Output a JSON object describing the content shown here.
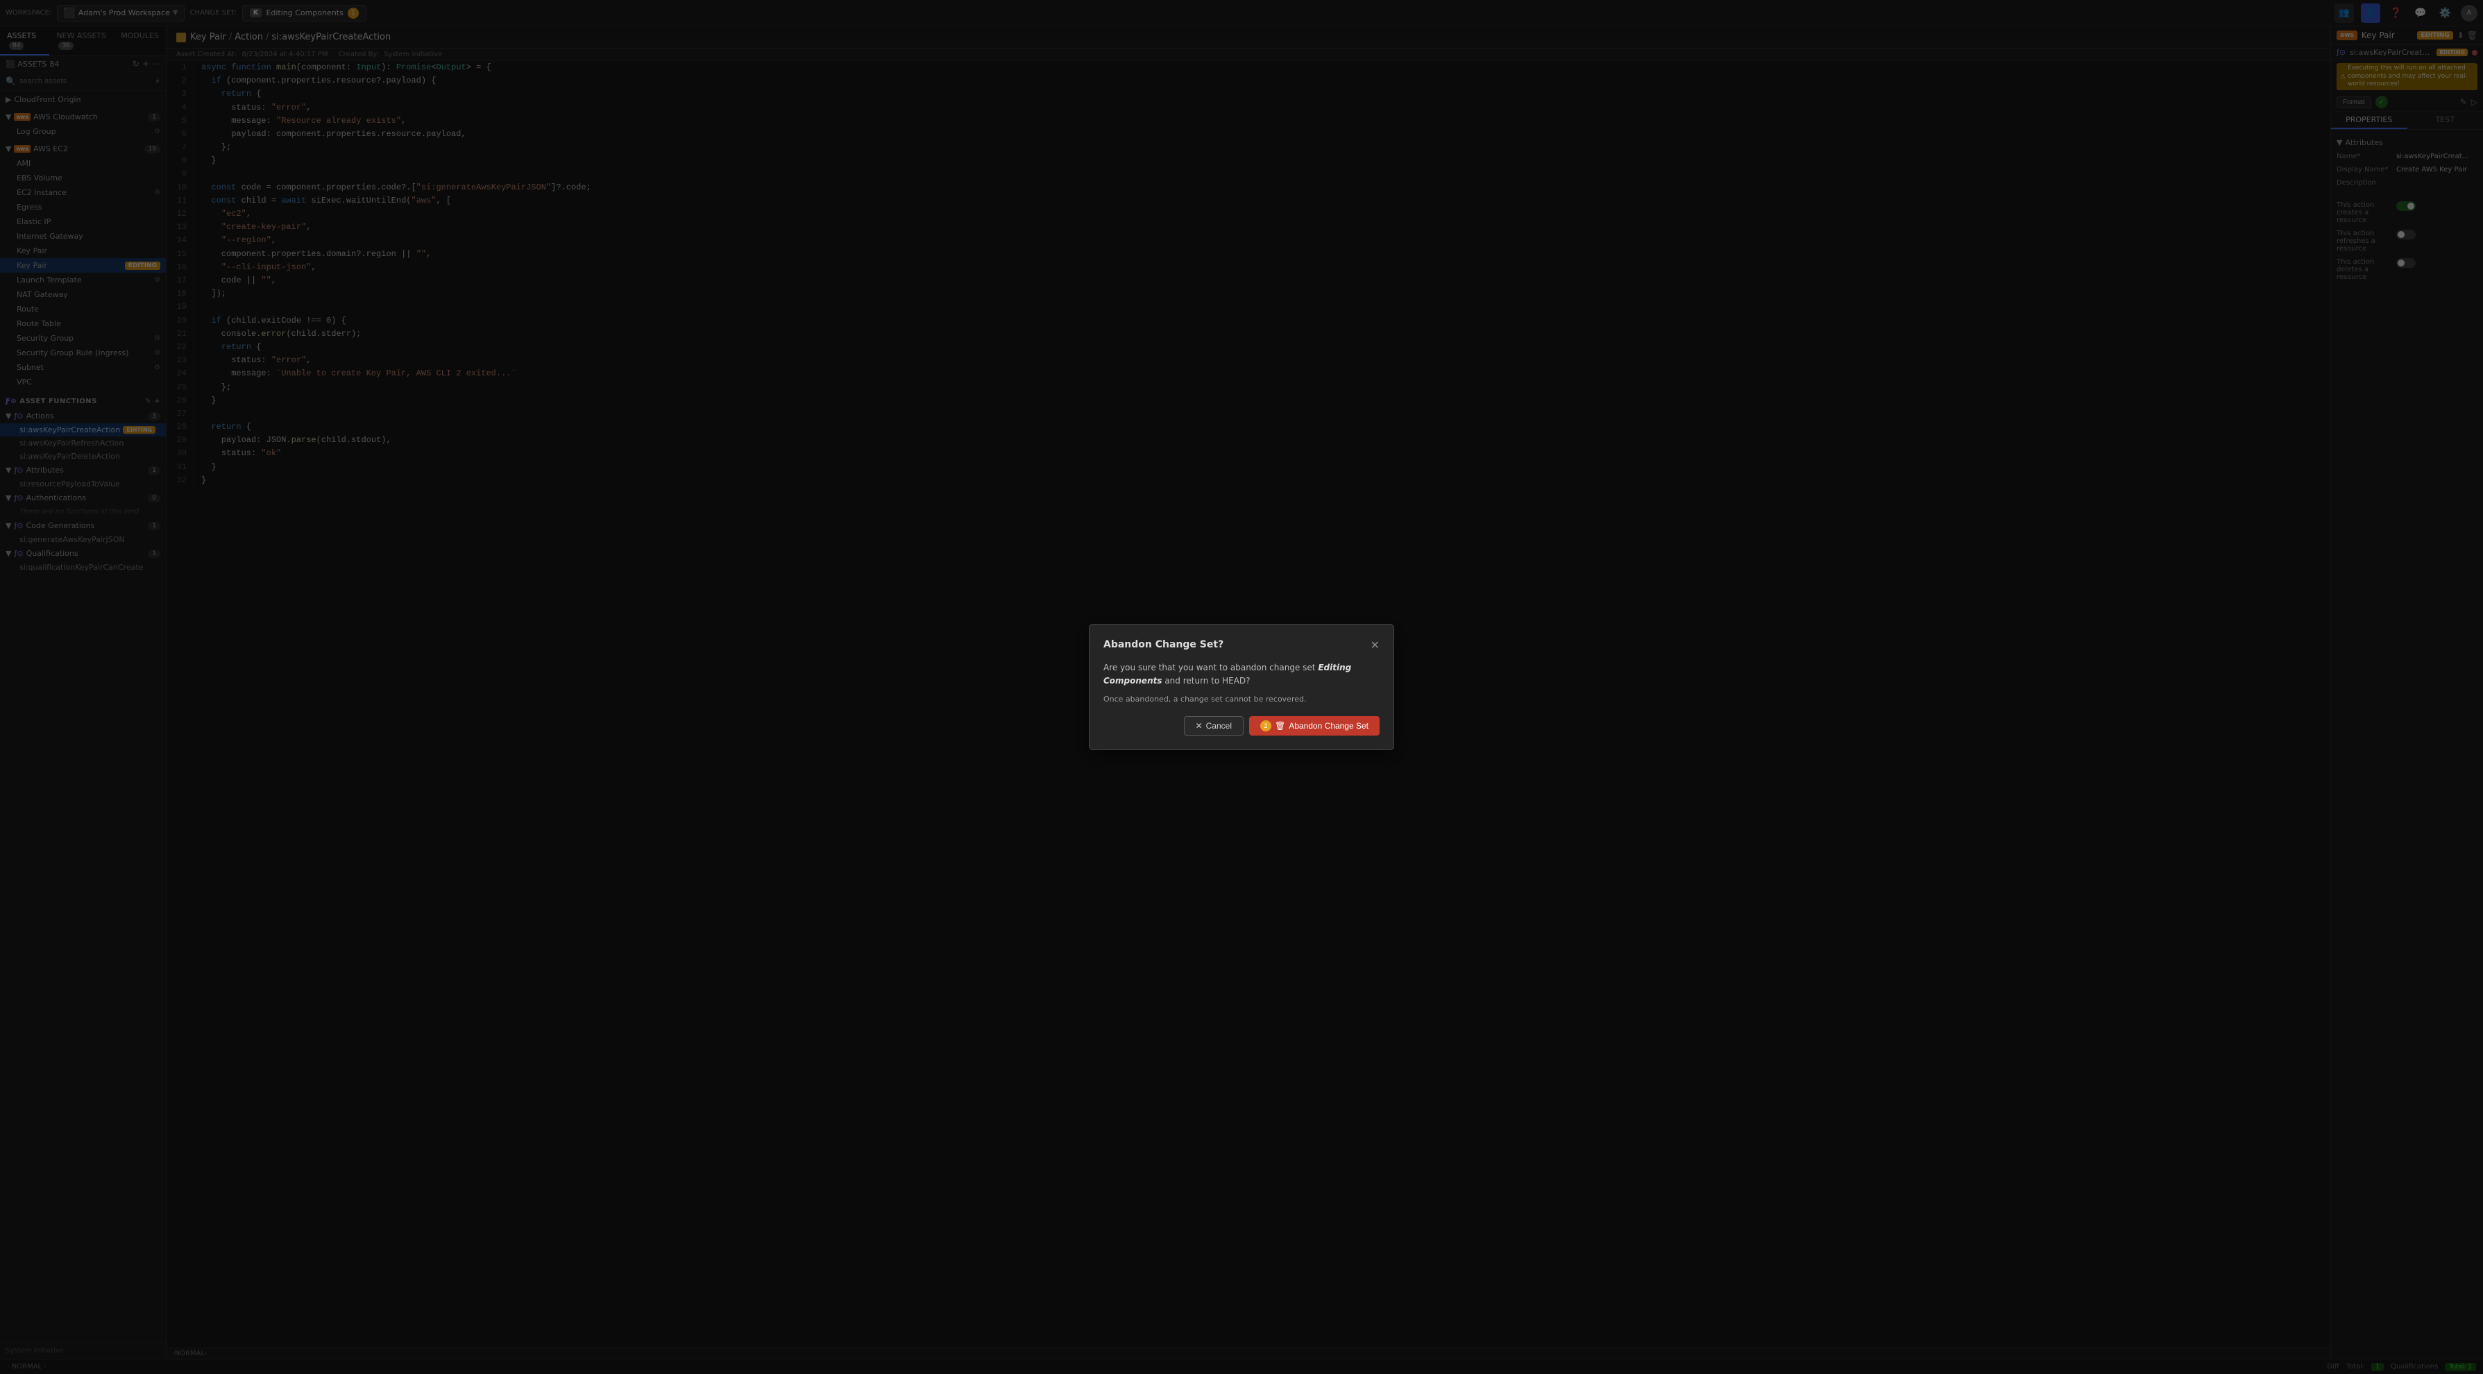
{
  "topbar": {
    "workspace_label": "WORKSPACE:",
    "workspace_name": "Adam's Prod Workspace",
    "changeset_label": "CHANGE SET:",
    "changeset_name": "Editing Components",
    "ks_label": "K",
    "notif_count": "1",
    "icons": [
      "people-icon",
      "user-icon",
      "question-icon",
      "discord-icon",
      "gear-icon",
      "avatar-icon"
    ]
  },
  "sidebar": {
    "tabs": [
      {
        "label": "ASSETS",
        "badge": "84",
        "active": true
      },
      {
        "label": "NEW ASSETS",
        "badge": "36",
        "active": false
      },
      {
        "label": "MODULES",
        "badge": "",
        "active": false
      }
    ],
    "search_placeholder": "search assets",
    "assets_count": "84",
    "groups": [
      {
        "name": "CloudFront Origin",
        "aws": false,
        "count": "",
        "items": []
      },
      {
        "name": "AWS Cloudwatch",
        "aws": true,
        "count": "1",
        "items": [
          {
            "label": "Log Group",
            "icon_right": "settings-icon"
          }
        ]
      },
      {
        "name": "AWS EC2",
        "aws": true,
        "count": "19",
        "items": [
          {
            "label": "AMI"
          },
          {
            "label": "EBS Volume"
          },
          {
            "label": "EC2 Instance",
            "icon_right": "settings-icon"
          },
          {
            "label": "Egress"
          },
          {
            "label": "Elastic IP"
          },
          {
            "label": "Internet Gateway"
          },
          {
            "label": "Key Pair"
          },
          {
            "label": "Key Pair",
            "editing": true,
            "active": true
          },
          {
            "label": "Launch Template",
            "icon_right": "settings-icon"
          },
          {
            "label": "NAT Gateway"
          },
          {
            "label": "Route"
          },
          {
            "label": "Route Table"
          },
          {
            "label": "Security Group",
            "icon_right": "settings-icon"
          },
          {
            "label": "Security Group Rule (Ingress)",
            "icon_right": "settings-icon"
          },
          {
            "label": "Subnet"
          },
          {
            "label": "VPC"
          }
        ]
      }
    ],
    "asset_functions_label": "ASSET FUNCTIONS",
    "functions_groups": [
      {
        "name": "Actions",
        "count": "3",
        "items": [
          {
            "label": "si:awsKeyPairCreateAction",
            "active": true,
            "editing": true
          },
          {
            "label": "si:awsKeyPairRefreshAction"
          },
          {
            "label": "si:awsKeyPairDeleteAction"
          }
        ]
      },
      {
        "name": "Attributes",
        "count": "1",
        "items": [
          {
            "label": "si:resourcePayloadToValue"
          }
        ]
      },
      {
        "name": "Authentications",
        "count": "0",
        "items": [],
        "empty_text": "There are no functions of this kind"
      },
      {
        "name": "Code Generations",
        "count": "1",
        "items": [
          {
            "label": "si:generateAwsKeyPairJSON"
          }
        ]
      },
      {
        "name": "Qualifications",
        "count": "1",
        "items": [
          {
            "label": "si:qualificationKeyPairCanCreate"
          }
        ]
      }
    ],
    "bottom_label": "System Initiative"
  },
  "editor": {
    "breadcrumb": {
      "icon": "key-icon",
      "parts": [
        "Key Pair",
        "Action",
        "si:awsKeyPairCreateAction"
      ]
    },
    "meta": {
      "created_at_label": "Asset Created At:",
      "created_at": "8/23/2024 at 4:40:17 PM",
      "created_by_label": "Created By:",
      "created_by": "System Initiative"
    },
    "lines": [
      {
        "num": 1,
        "content": "async function main(component: Input): Promise<Output> = {"
      },
      {
        "num": 2,
        "content": "  if (component.properties.resource?.payload) {"
      },
      {
        "num": 3,
        "content": "    return {"
      },
      {
        "num": 4,
        "content": "      status: \"error\","
      },
      {
        "num": 5,
        "content": "      message: \"Resource already exists\","
      },
      {
        "num": 6,
        "content": "      payload: component.properties.resource.payload,"
      },
      {
        "num": 7,
        "content": "    };"
      },
      {
        "num": 8,
        "content": "  }"
      },
      {
        "num": 9,
        "content": ""
      },
      {
        "num": 10,
        "content": "  const code = component.properties.code?.[\"si:generateAwsKeyPairJSON\"]?.code;"
      },
      {
        "num": 11,
        "content": "  const child = await siExec.waitUntilEnd(\"aws\", ["
      },
      {
        "num": 12,
        "content": "    \"ec2\","
      },
      {
        "num": 13,
        "content": "    \"create-key-pair\","
      },
      {
        "num": 14,
        "content": "    \"--region\","
      },
      {
        "num": 15,
        "content": "    component.properties.domain?.region || \"\","
      },
      {
        "num": 16,
        "content": "    \"--cli-input-json\","
      },
      {
        "num": 17,
        "content": "    code || \"\","
      },
      {
        "num": 18,
        "content": "  ]);"
      },
      {
        "num": 19,
        "content": ""
      },
      {
        "num": 20,
        "content": "  if (child.exitCode !== 0) {"
      },
      {
        "num": 21,
        "content": "    console.error(child.stderr);"
      },
      {
        "num": 22,
        "content": "    return {"
      },
      {
        "num": 23,
        "content": "      status: \"error\","
      },
      {
        "num": 24,
        "content": "      message: `Unable to create Key Pair, AWS CLI 2 exited...`"
      },
      {
        "num": 25,
        "content": "    };"
      },
      {
        "num": 26,
        "content": "  }"
      },
      {
        "num": 27,
        "content": ""
      },
      {
        "num": 28,
        "content": "  return {"
      },
      {
        "num": 29,
        "content": "    payload: JSON.parse(child.stdout),"
      },
      {
        "num": 30,
        "content": "    status: \"ok\""
      },
      {
        "num": 31,
        "content": "  }"
      },
      {
        "num": 32,
        "content": "}"
      }
    ],
    "statusbar": "-NORMAL-"
  },
  "right_sidebar": {
    "aws_label": "aws",
    "title": "Key Pair",
    "editing_label": "EDITING",
    "func_name": "si:awsKeyPairCreateAction",
    "func_editing": "EDITING",
    "warning": "Executing this will run on all attached components and may affect your real-world resources!",
    "format_btn": "Format",
    "tabs": [
      {
        "label": "PROPERTIES",
        "active": true
      },
      {
        "label": "TEST",
        "active": false
      }
    ],
    "attributes_header": "Attributes",
    "attrs": [
      {
        "label": "Name*",
        "value": "si:awsKeyPairCreat..."
      },
      {
        "label": "Display Name*",
        "value": "Create AWS Key Pair"
      },
      {
        "label": "Description",
        "value": ""
      },
      {
        "label": "This action creates a resource",
        "toggle": "on"
      },
      {
        "label": "This action refreshes a resource",
        "toggle": "off"
      },
      {
        "label": "This action deletes a resource",
        "toggle": "off"
      }
    ]
  },
  "modal": {
    "title": "Abandon Change Set?",
    "body_prefix": "Are you sure that you want to abandon change set",
    "change_set_name": "Editing Components",
    "body_suffix": "and return to HEAD?",
    "note": "Once abandoned, a change set cannot be recovered.",
    "cancel_btn": "Cancel",
    "abandon_btn": "Abandon Change Set",
    "badge_count": "2"
  },
  "bottom_bar": {
    "mode": "- NORMAL -",
    "diff_label": "Diff",
    "total_label": "Total:",
    "total_value": "1",
    "qualifications_label": "Qualifications",
    "qual_total": "Total: 1"
  }
}
